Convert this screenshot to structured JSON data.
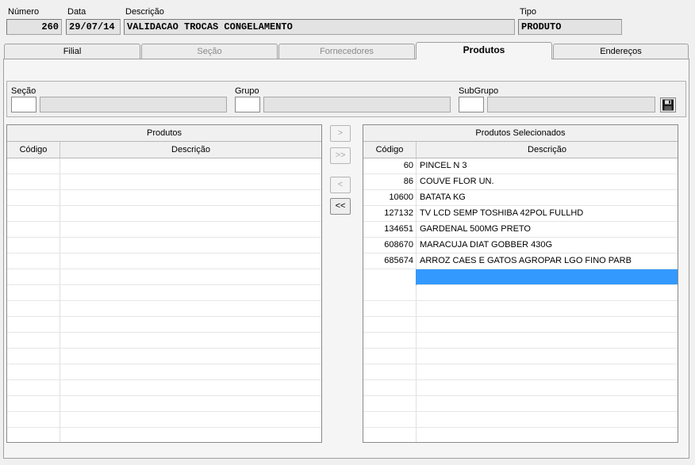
{
  "header": {
    "numero_label": "Número",
    "numero_value": "260",
    "data_label": "Data",
    "data_value": "29/07/14",
    "descricao_label": "Descrição",
    "descricao_value": "VALIDACAO TROCAS CONGELAMENTO",
    "tipo_label": "Tipo",
    "tipo_value": "PRODUTO"
  },
  "tabs": [
    {
      "label": "Filial",
      "state": "enabled"
    },
    {
      "label": "Seção",
      "state": "disabled"
    },
    {
      "label": "Fornecedores",
      "state": "disabled"
    },
    {
      "label": "Produtos",
      "state": "active"
    },
    {
      "label": "Endereços",
      "state": "enabled"
    }
  ],
  "filters": {
    "secao_label": "Seção",
    "grupo_label": "Grupo",
    "subgrupo_label": "SubGrupo"
  },
  "left_grid": {
    "title": "Produtos",
    "col_codigo": "Código",
    "col_descricao": "Descrição",
    "rows": []
  },
  "transfer_buttons": {
    "add_one": ">",
    "add_all": ">>",
    "remove_one": "<",
    "remove_all": "<<"
  },
  "right_grid": {
    "title": "Produtos Selecionados",
    "col_codigo": "Código",
    "col_descricao": "Descrição",
    "rows": [
      {
        "codigo": "60",
        "descricao": "PINCEL N 3"
      },
      {
        "codigo": "86",
        "descricao": "COUVE FLOR UN."
      },
      {
        "codigo": "10600",
        "descricao": "BATATA KG"
      },
      {
        "codigo": "127132",
        "descricao": "TV LCD SEMP TOSHIBA 42POL FULLHD"
      },
      {
        "codigo": "134651",
        "descricao": "GARDENAL 500MG PRETO"
      },
      {
        "codigo": "608670",
        "descricao": "MARACUJA DIAT GOBBER 430G"
      },
      {
        "codigo": "685674",
        "descricao": "ARROZ CAES E GATOS AGROPAR LGO FINO PARB"
      }
    ]
  },
  "colors": {
    "selection": "#3399ff"
  }
}
